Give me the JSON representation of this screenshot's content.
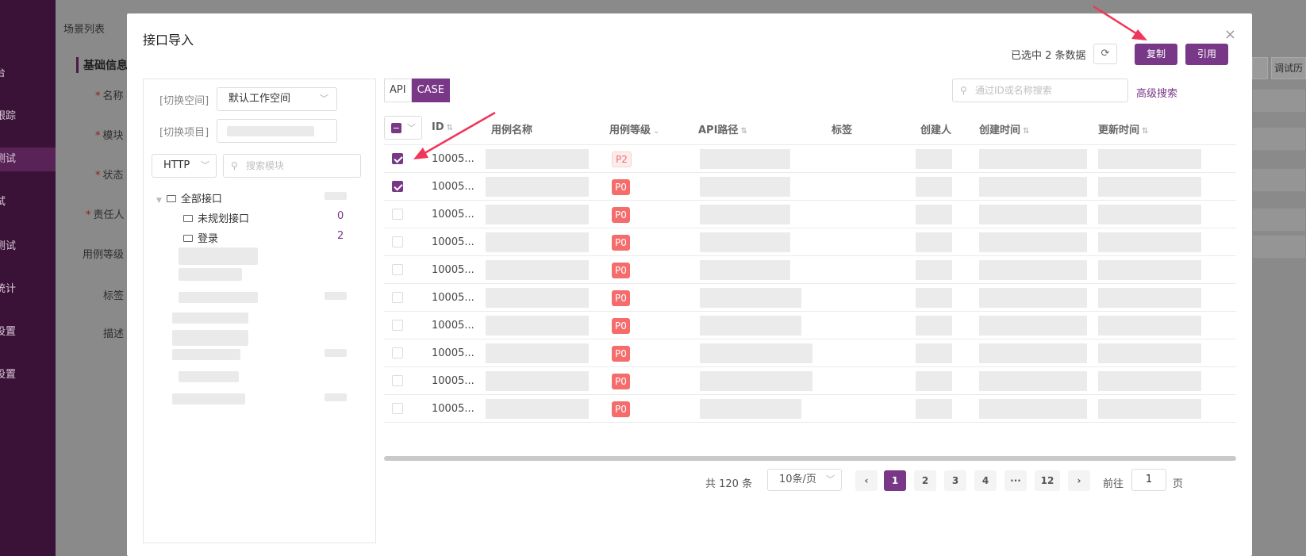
{
  "background": {
    "sidebar_items": [
      "台",
      "跟踪",
      "测试",
      "试",
      "测试",
      "统计",
      "设置",
      "设置"
    ],
    "tabs": "场景列表",
    "section_title": "基础信息",
    "form_labels": [
      {
        "text": "名称",
        "required": true
      },
      {
        "text": "模块",
        "required": true
      },
      {
        "text": "状态",
        "required": true
      },
      {
        "text": "责任人",
        "required": true
      },
      {
        "text": "用例等级",
        "required": false
      },
      {
        "text": "标签",
        "required": false
      },
      {
        "text": "描述",
        "required": false
      }
    ],
    "right_button": "调试历"
  },
  "dialog": {
    "title": "接口导入",
    "close_icon": "×",
    "selected_info": "已选中 2 条数据",
    "refresh_icon": "⟳",
    "copy_label": "复制",
    "reference_label": "引用"
  },
  "left_panel": {
    "switch_space_label": "[切换空间]",
    "space_value": "默认工作空间",
    "switch_project_label": "[切换项目]",
    "protocol": "HTTP",
    "module_search_placeholder": "搜索模块",
    "tree": {
      "root": "全部接口",
      "children": [
        {
          "label": "未规划接口",
          "count": "0"
        },
        {
          "label": "登录",
          "count": "2"
        }
      ]
    }
  },
  "right_panel": {
    "seg_api": "API",
    "seg_case": "CASE",
    "search_placeholder": "通过ID或名称搜索",
    "advanced_search": "高级搜索",
    "columns": {
      "id": "ID",
      "name": "用例名称",
      "level": "用例等级",
      "path": "API路径",
      "tag": "标签",
      "creator": "创建人",
      "created": "创建时间",
      "updated": "更新时间"
    },
    "rows": [
      {
        "id": "10005...",
        "level": "P2",
        "checked": true
      },
      {
        "id": "10005...",
        "level": "P0",
        "checked": true
      },
      {
        "id": "10005...",
        "level": "P0",
        "checked": false
      },
      {
        "id": "10005...",
        "level": "P0",
        "checked": false
      },
      {
        "id": "10005...",
        "level": "P0",
        "checked": false
      },
      {
        "id": "10005...",
        "level": "P0",
        "checked": false
      },
      {
        "id": "10005...",
        "level": "P0",
        "checked": false
      },
      {
        "id": "10005...",
        "level": "P0",
        "checked": false
      },
      {
        "id": "10005...",
        "level": "P0",
        "checked": false
      },
      {
        "id": "10005...",
        "level": "P0",
        "checked": false
      }
    ]
  },
  "pagination": {
    "total": "共 120 条",
    "page_size": "10条/页",
    "prev": "‹",
    "pages": [
      "1",
      "2",
      "3",
      "4",
      "···",
      "12"
    ],
    "next": "›",
    "goto_label": "前往",
    "goto_value": "1",
    "page_suffix": "页"
  },
  "colors": {
    "primary": "#783887",
    "danger": "#f56c6c",
    "annotation": "#f0365a"
  }
}
